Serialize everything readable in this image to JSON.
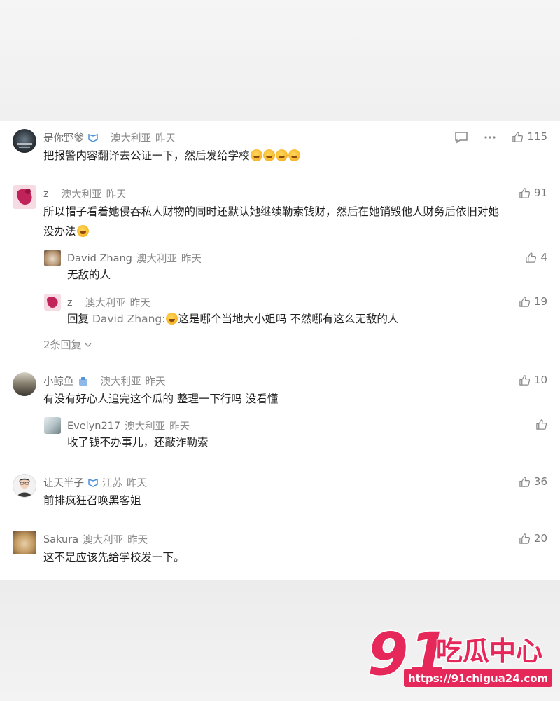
{
  "comments": [
    {
      "user": "是你野爹",
      "location": "澳大利亚",
      "time": "昨天",
      "text": "把报警内容翻译去公证一下，然后发给学校",
      "likes": "115",
      "emojis": 4
    },
    {
      "user": "z",
      "location": "澳大利亚",
      "time": "昨天",
      "text_line1": "所以帽子看着她侵吞私人财物的同时还默认她继续勒索钱财，然后在她销毁他人财务后依旧对她",
      "text_line2": "没办法",
      "likes": "91",
      "replies": [
        {
          "user": "David Zhang",
          "location": "澳大利亚",
          "time": "昨天",
          "text": "无敌的人",
          "likes": "4"
        },
        {
          "user": "z",
          "location": "澳大利亚",
          "time": "昨天",
          "reply_prefix": "回复",
          "reply_to": "David Zhang",
          "text": "这是哪个当地大小姐吗 不然哪有这么无敌的人",
          "likes": "19"
        }
      ],
      "more_replies": "2条回复"
    },
    {
      "user": "小鲸鱼",
      "location": "澳大利亚",
      "time": "昨天",
      "text": "有没有好心人追完这个瓜的 整理一下行吗 没看懂",
      "likes": "10",
      "replies": [
        {
          "user": "Evelyn217",
          "location": "澳大利亚",
          "time": "昨天",
          "text": "收了钱不办事儿，还敲诈勒索"
        }
      ]
    },
    {
      "user": "让天半子",
      "location": "江苏",
      "time": "昨天",
      "text": "前排疯狂召唤黑客姐",
      "likes": "36"
    },
    {
      "user": "Sakura",
      "location": "澳大利亚",
      "time": "昨天",
      "text": "这不是应该先给学校发一下。",
      "likes": "20"
    }
  ],
  "watermark": {
    "number": "91",
    "title": "吃瓜中心",
    "url": "https://91chigua24.com"
  },
  "colors": {
    "brand": "#e6275a",
    "verified": "#4a90d9"
  }
}
